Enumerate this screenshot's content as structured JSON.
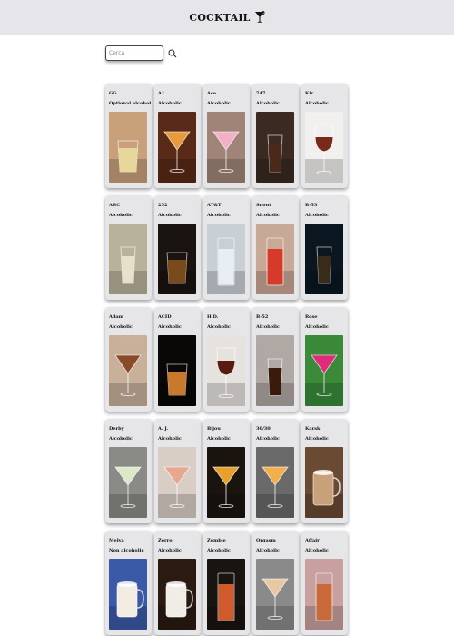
{
  "header": {
    "title": "COCKTAIL",
    "icon": "cocktail-glass-icon"
  },
  "search": {
    "placeholder": "Cerca",
    "icon": "search-icon"
  },
  "cocktails": [
    {
      "name": "GG",
      "type": "Optional alcohol",
      "bg": "#c8a07a",
      "drink": "#e8d79a",
      "glass": "tumbler"
    },
    {
      "name": "A1",
      "type": "Alcoholic",
      "bg": "#5a2a18",
      "drink": "#e89a3a",
      "glass": "martini"
    },
    {
      "name": "Ace",
      "type": "Alcoholic",
      "bg": "#a08478",
      "drink": "#f2b0c8",
      "glass": "martini"
    },
    {
      "name": "747",
      "type": "Alcoholic",
      "bg": "#3a2a22",
      "drink": "#4a2a1a",
      "glass": "shot"
    },
    {
      "name": "Kir",
      "type": "Alcoholic",
      "bg": "#f2f0ee",
      "drink": "#7a2a1a",
      "glass": "wine"
    },
    {
      "name": "ABC",
      "type": "Alcoholic",
      "bg": "#b8b29a",
      "drink": "#e8e0c8",
      "glass": "shot"
    },
    {
      "name": "252",
      "type": "Alcoholic",
      "bg": "#1a1410",
      "drink": "#7a4a1a",
      "glass": "tumbler"
    },
    {
      "name": "AT&T",
      "type": "Alcoholic",
      "bg": "#c8d0d6",
      "drink": "#e8eef2",
      "glass": "highball"
    },
    {
      "name": "Snout",
      "type": "Alcoholic",
      "bg": "#c8a896",
      "drink": "#d83a2a",
      "glass": "highball"
    },
    {
      "name": "B-53",
      "type": "Alcoholic",
      "bg": "#0a1620",
      "drink": "#3a2a1a",
      "glass": "shot"
    },
    {
      "name": "Adam",
      "type": "Alcoholic",
      "bg": "#c8b09a",
      "drink": "#8a4a2a",
      "glass": "martini"
    },
    {
      "name": "ACID",
      "type": "Alcoholic",
      "bg": "#0a0806",
      "drink": "#c87a2a",
      "glass": "tumbler"
    },
    {
      "name": "H.D.",
      "type": "Alcoholic",
      "bg": "#e6e2de",
      "drink": "#5a1a10",
      "glass": "wine"
    },
    {
      "name": "B-52",
      "type": "Alcoholic",
      "bg": "#b0a8a4",
      "drink": "#3a1a0a",
      "glass": "shot"
    },
    {
      "name": "Rose",
      "type": "Alcoholic",
      "bg": "#3a8a3a",
      "drink": "#e02a7a",
      "glass": "martini"
    },
    {
      "name": "Derby",
      "type": "Alcoholic",
      "bg": "#8a8a86",
      "drink": "#dce8c8",
      "glass": "martini"
    },
    {
      "name": "A. J.",
      "type": "Alcoholic",
      "bg": "#d8cec6",
      "drink": "#e8a890",
      "glass": "martini"
    },
    {
      "name": "Bijou",
      "type": "Alcoholic",
      "bg": "#1a140e",
      "drink": "#e8a02a",
      "glass": "martini"
    },
    {
      "name": "30/30",
      "type": "Alcoholic",
      "bg": "#6a6a6a",
      "drink": "#f2b04a",
      "glass": "martini"
    },
    {
      "name": "Karsk",
      "type": "Alcoholic",
      "bg": "#6a4a32",
      "drink": "#c8a07a",
      "glass": "mug"
    },
    {
      "name": "Melya",
      "type": "Non alcoholic",
      "bg": "#3a5aa8",
      "drink": "#f2ece2",
      "glass": "mug"
    },
    {
      "name": "Zorro",
      "type": "Alcoholic",
      "bg": "#2a1a12",
      "drink": "#f0ece6",
      "glass": "mug"
    },
    {
      "name": "Zombie",
      "type": "Alcoholic",
      "bg": "#1a1410",
      "drink": "#d05a2a",
      "glass": "highball"
    },
    {
      "name": "Orgasm",
      "type": "Alcoholic",
      "bg": "#8a8a8a",
      "drink": "#e8c8a0",
      "glass": "martini"
    },
    {
      "name": "Affair",
      "type": "Alcoholic",
      "bg": "#c8a0a0",
      "drink": "#c86a3a",
      "glass": "highball"
    }
  ]
}
